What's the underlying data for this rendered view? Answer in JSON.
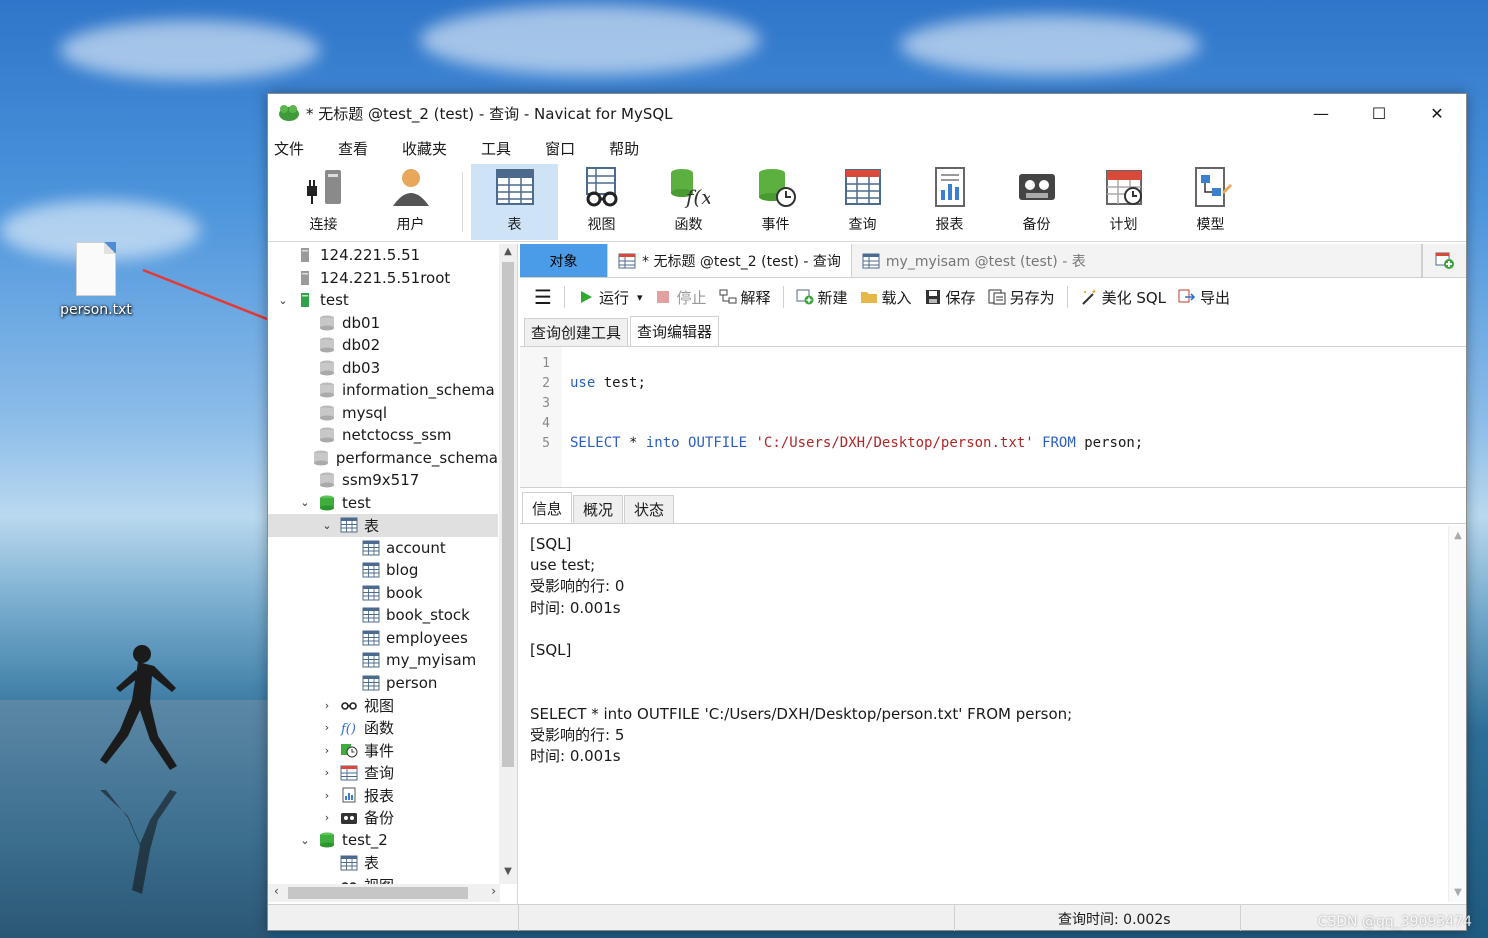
{
  "desktop": {
    "file_name": "person.txt",
    "watermark": "CSDN @qq_39093474"
  },
  "window": {
    "title": "* 无标题 @test_2 (test) - 查询 - Navicat for MySQL",
    "controls": {
      "minimize": "—",
      "maximize": "☐",
      "close": "✕"
    }
  },
  "menu": [
    "文件",
    "查看",
    "收藏夹",
    "工具",
    "窗口",
    "帮助"
  ],
  "toolbar": [
    {
      "label": "连接",
      "icon": "plug-connect-icon"
    },
    {
      "label": "用户",
      "icon": "user-icon"
    },
    {
      "label": "表",
      "icon": "table-icon",
      "active": true
    },
    {
      "label": "视图",
      "icon": "view-glasses-icon"
    },
    {
      "label": "函数",
      "icon": "function-icon"
    },
    {
      "label": "事件",
      "icon": "event-clock-icon"
    },
    {
      "label": "查询",
      "icon": "query-icon"
    },
    {
      "label": "报表",
      "icon": "report-icon"
    },
    {
      "label": "备份",
      "icon": "backup-tape-icon"
    },
    {
      "label": "计划",
      "icon": "schedule-calendar-icon"
    },
    {
      "label": "模型",
      "icon": "model-icon"
    }
  ],
  "tree": [
    {
      "label": "124.221.5.51",
      "level": 0,
      "icon": "server-icon",
      "chev": ""
    },
    {
      "label": "124.221.5.51root",
      "level": 0,
      "icon": "server-icon",
      "chev": ""
    },
    {
      "label": "test",
      "level": 0,
      "icon": "server-green-icon",
      "chev": "⌄"
    },
    {
      "label": "db01",
      "level": 1,
      "icon": "database-gray-icon",
      "chev": ""
    },
    {
      "label": "db02",
      "level": 1,
      "icon": "database-gray-icon",
      "chev": ""
    },
    {
      "label": "db03",
      "level": 1,
      "icon": "database-gray-icon",
      "chev": ""
    },
    {
      "label": "information_schema",
      "level": 1,
      "icon": "database-gray-icon",
      "chev": ""
    },
    {
      "label": "mysql",
      "level": 1,
      "icon": "database-gray-icon",
      "chev": ""
    },
    {
      "label": "netctocss_ssm",
      "level": 1,
      "icon": "database-gray-icon",
      "chev": ""
    },
    {
      "label": "performance_schema",
      "level": 1,
      "icon": "database-gray-icon",
      "chev": ""
    },
    {
      "label": "ssm9x517",
      "level": 1,
      "icon": "database-gray-icon",
      "chev": ""
    },
    {
      "label": "test",
      "level": 1,
      "icon": "database-green-icon",
      "chev": "⌄"
    },
    {
      "label": "表",
      "level": 2,
      "icon": "table-icon",
      "chev": "⌄",
      "selected": true
    },
    {
      "label": "account",
      "level": 3,
      "icon": "table-icon",
      "chev": ""
    },
    {
      "label": "blog",
      "level": 3,
      "icon": "table-icon",
      "chev": ""
    },
    {
      "label": "book",
      "level": 3,
      "icon": "table-icon",
      "chev": ""
    },
    {
      "label": "book_stock",
      "level": 3,
      "icon": "table-icon",
      "chev": ""
    },
    {
      "label": "employees",
      "level": 3,
      "icon": "table-icon",
      "chev": ""
    },
    {
      "label": "my_myisam",
      "level": 3,
      "icon": "table-icon",
      "chev": ""
    },
    {
      "label": "person",
      "level": 3,
      "icon": "table-icon",
      "chev": ""
    },
    {
      "label": "视图",
      "level": 2,
      "icon": "view-glasses-icon",
      "chev": "›"
    },
    {
      "label": "函数",
      "level": 2,
      "icon": "function-icon",
      "chev": "›"
    },
    {
      "label": "事件",
      "level": 2,
      "icon": "event-clock-icon",
      "chev": "›"
    },
    {
      "label": "查询",
      "level": 2,
      "icon": "query-icon",
      "chev": "›"
    },
    {
      "label": "报表",
      "level": 2,
      "icon": "report-icon",
      "chev": "›"
    },
    {
      "label": "备份",
      "level": 2,
      "icon": "backup-tape-icon",
      "chev": "›"
    },
    {
      "label": "test_2",
      "level": 1,
      "icon": "database-green-icon",
      "chev": "⌄"
    },
    {
      "label": "表",
      "level": 2,
      "icon": "table-icon",
      "chev": ""
    },
    {
      "label": "视图",
      "level": 2,
      "icon": "view-glasses-icon",
      "chev": ""
    }
  ],
  "tabs": {
    "objects": "对象",
    "current": "* 无标题 @test_2 (test) - 查询",
    "other": "my_myisam @test (test) - 表"
  },
  "query_toolbar": {
    "menu_icon": "☰",
    "run": "运行",
    "run_dropdown": "▾",
    "stop": "停止",
    "explain": "解释",
    "new": "新建",
    "load": "载入",
    "save": "保存",
    "save_as": "另存为",
    "beautify": "美化 SQL",
    "export": "导出"
  },
  "subtabs": [
    "查询创建工具",
    "查询编辑器"
  ],
  "editor": {
    "lines": [
      {
        "n": "1",
        "parts": []
      },
      {
        "n": "2",
        "parts": [
          {
            "t": "use",
            "c": "kw"
          },
          {
            "t": " test;",
            "c": ""
          }
        ]
      },
      {
        "n": "3",
        "parts": []
      },
      {
        "n": "4",
        "parts": []
      },
      {
        "n": "5",
        "parts": [
          {
            "t": "SELECT",
            "c": "kw"
          },
          {
            "t": " * ",
            "c": ""
          },
          {
            "t": "into",
            "c": "kw"
          },
          {
            "t": " ",
            "c": ""
          },
          {
            "t": "OUTFILE",
            "c": "kw"
          },
          {
            "t": " ",
            "c": ""
          },
          {
            "t": "'C:/Users/DXH/Desktop/person.txt'",
            "c": "str"
          },
          {
            "t": " ",
            "c": ""
          },
          {
            "t": "FROM",
            "c": "kw"
          },
          {
            "t": " person;",
            "c": ""
          }
        ]
      }
    ]
  },
  "result_tabs": [
    "信息",
    "概况",
    "状态"
  ],
  "result_lines": [
    "[SQL]",
    "use test;",
    "受影响的行: 0",
    "时间: 0.001s",
    "",
    "[SQL]",
    "",
    "",
    "SELECT * into OUTFILE 'C:/Users/DXH/Desktop/person.txt' FROM person;",
    "受影响的行: 5",
    "时间: 0.001s"
  ],
  "status": {
    "query_time": "查询时间: 0.002s"
  },
  "colors": {
    "selected_tab": "#4a9be8",
    "active_tool": "#cfe3f7",
    "keyword": "#2b5fc4",
    "string": "#b22525",
    "arrow": "#e53935"
  }
}
